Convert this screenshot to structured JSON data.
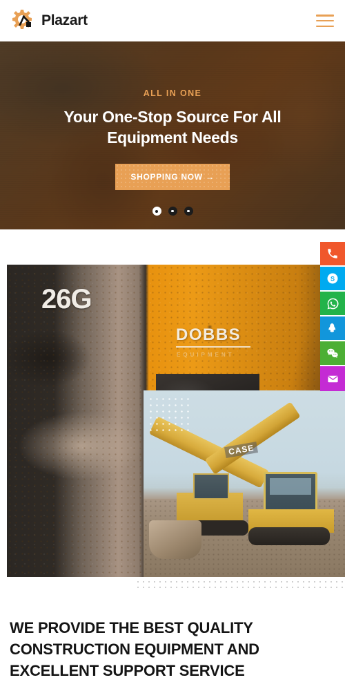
{
  "header": {
    "brand_name": "Plazart",
    "logo_icon": "gear-excavator-logo",
    "menu_icon": "hamburger-menu-icon"
  },
  "hero": {
    "eyebrow": "ALL IN ONE",
    "title": "Your One-Stop Source For All Equipment Needs",
    "cta_label": "SHOPPING NOW →",
    "accent_color": "#E8A055",
    "slides": [
      {
        "label": "slide-1",
        "active": true
      },
      {
        "label": "slide-2",
        "active": false
      },
      {
        "label": "slide-3",
        "active": false
      }
    ]
  },
  "social_rail": [
    {
      "name": "phone-icon",
      "label": "Phone",
      "color": "#F0572C"
    },
    {
      "name": "skype-icon",
      "label": "Skype",
      "color": "#00AAF0"
    },
    {
      "name": "whatsapp-icon",
      "label": "WhatsApp",
      "color": "#22B34A"
    },
    {
      "name": "qq-icon",
      "label": "QQ",
      "color": "#1296DB"
    },
    {
      "name": "wechat-icon",
      "label": "WeChat",
      "color": "#4CAF35"
    },
    {
      "name": "email-icon",
      "label": "Email",
      "color": "#C42BD4"
    }
  ],
  "media": {
    "main_image": {
      "name": "excavator-closeup-image",
      "brand_text": "DOBBS",
      "brand_sub": "EQUIPMENT",
      "plate_number": "26G"
    },
    "inset_image": {
      "name": "case-excavator-yard-image",
      "badge_text": "CASE"
    }
  },
  "about": {
    "heading": "WE PROVIDE THE BEST QUALITY CONSTRUCTION EQUIPMENT AND EXCELLENT SUPPORT SERVICE"
  }
}
